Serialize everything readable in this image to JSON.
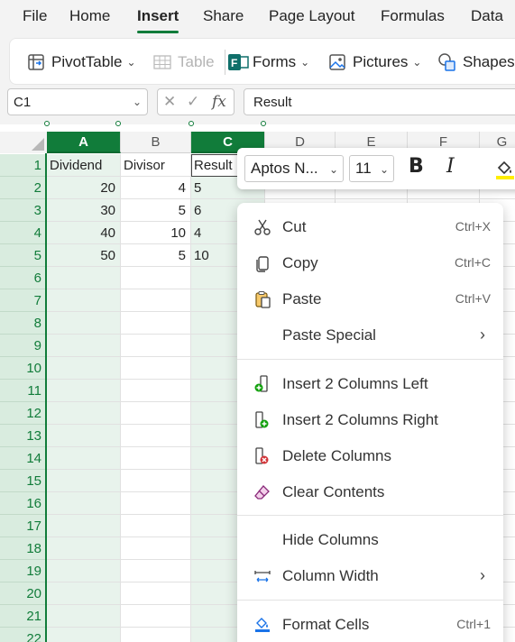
{
  "menu": {
    "tabs": [
      "File",
      "Home",
      "Insert",
      "Share",
      "Page Layout",
      "Formulas",
      "Data"
    ],
    "active": "Insert"
  },
  "ribbon": {
    "pivottable": "PivotTable",
    "table": "Table",
    "forms": "Forms",
    "pictures": "Pictures",
    "shapes": "Shapes"
  },
  "formula_bar": {
    "name_box": "C1",
    "fx_symbol": "fx",
    "content": "Result"
  },
  "sheet": {
    "columns": [
      "A",
      "B",
      "C",
      "D",
      "E",
      "F",
      "G"
    ],
    "selected_column": "C",
    "rows": [
      "1",
      "2",
      "3",
      "4",
      "5",
      "6",
      "7",
      "8",
      "9",
      "10",
      "11",
      "12",
      "13",
      "14",
      "15",
      "16",
      "17",
      "18",
      "19",
      "20",
      "21",
      "22"
    ],
    "data": [
      [
        "Dividend",
        "Divisor",
        "Result"
      ],
      [
        "20",
        "4",
        "5"
      ],
      [
        "30",
        "5",
        "6"
      ],
      [
        "40",
        "10",
        "4"
      ],
      [
        "50",
        "5",
        "10"
      ]
    ]
  },
  "mini_toolbar": {
    "font": "Aptos N...",
    "size": "11",
    "bold": "B",
    "italic": "I"
  },
  "context_menu": {
    "cut": {
      "label": "Cut",
      "shortcut": "Ctrl+X"
    },
    "copy": {
      "label": "Copy",
      "shortcut": "Ctrl+C"
    },
    "paste": {
      "label": "Paste",
      "shortcut": "Ctrl+V"
    },
    "paste_special": {
      "label": "Paste Special"
    },
    "insert_left": {
      "label": "Insert 2 Columns Left"
    },
    "insert_right": {
      "label": "Insert 2 Columns Right"
    },
    "delete_columns": {
      "label": "Delete Columns"
    },
    "clear_contents": {
      "label": "Clear Contents"
    },
    "hide_columns": {
      "label": "Hide Columns"
    },
    "column_width": {
      "label": "Column Width"
    },
    "format_cells": {
      "label": "Format Cells",
      "shortcut": "Ctrl+1"
    }
  },
  "colors": {
    "accent": "#117c3a",
    "selected_header_bg": "#117c3a",
    "selected_column_bg": "#e8f3ec"
  }
}
